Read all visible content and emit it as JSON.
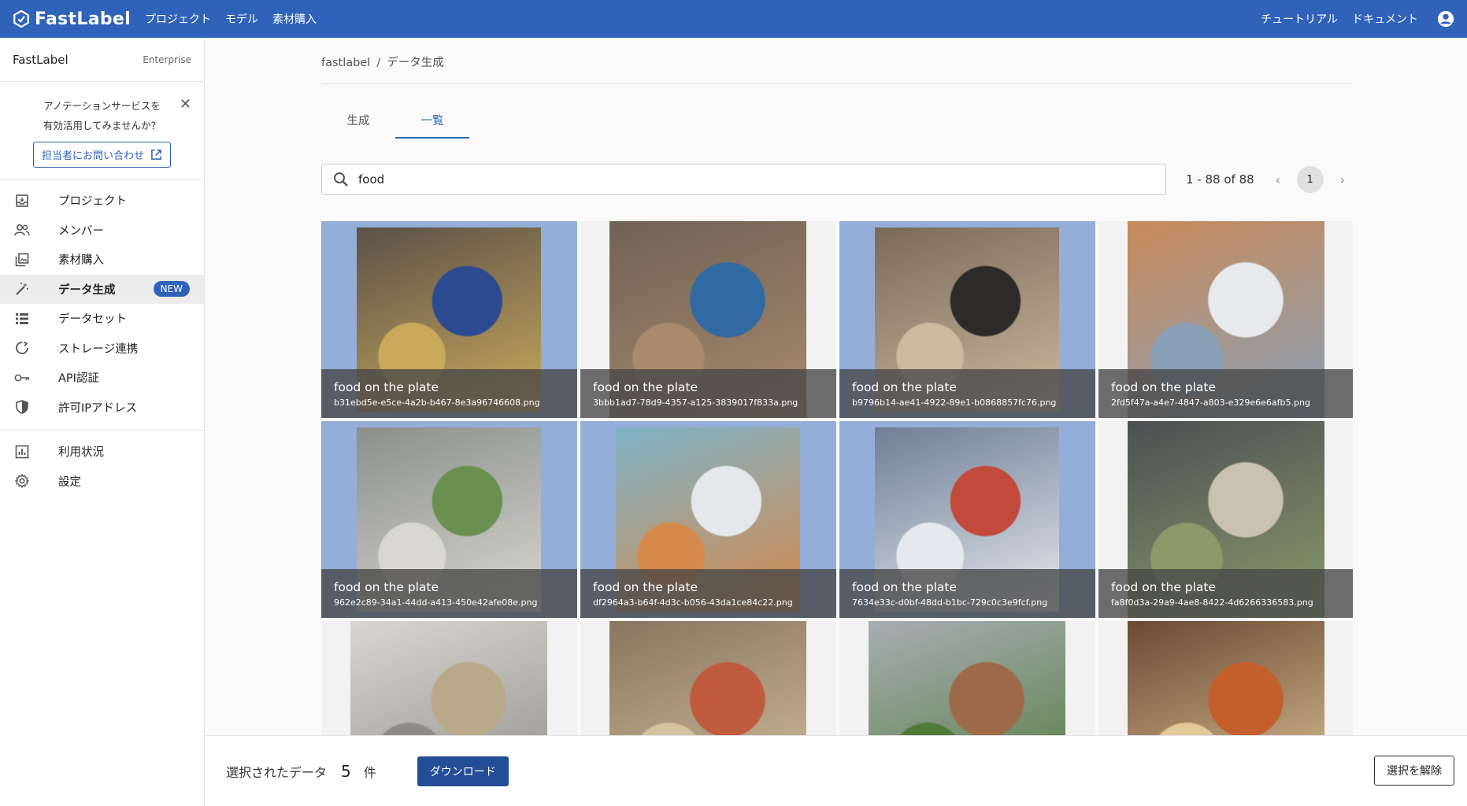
{
  "topbar": {
    "brand": "FastLabel",
    "nav": [
      "プロジェクト",
      "モデル",
      "素材購入"
    ],
    "right_links": [
      "チュートリアル",
      "ドキュメント"
    ]
  },
  "sidebar": {
    "org_name": "FastLabel",
    "plan": "Enterprise",
    "promo": {
      "line1": "アノテーションサービスを",
      "line2": "有効活用してみませんか？",
      "button": "担当者にお問い合わせ"
    },
    "items": [
      {
        "label": "プロジェクト",
        "icon": "inbox-icon"
      },
      {
        "label": "メンバー",
        "icon": "people-icon"
      },
      {
        "label": "素材購入",
        "icon": "gallery-icon"
      },
      {
        "label": "データ生成",
        "icon": "magic-wand-icon",
        "badge": "NEW"
      },
      {
        "label": "データセット",
        "icon": "list-icon"
      },
      {
        "label": "ストレージ連携",
        "icon": "sync-icon"
      },
      {
        "label": "API認証",
        "icon": "key-icon"
      },
      {
        "label": "許可IPアドレス",
        "icon": "shield-icon"
      }
    ],
    "items2": [
      {
        "label": "利用状況",
        "icon": "bar-chart-icon"
      },
      {
        "label": "設定",
        "icon": "gear-icon"
      }
    ]
  },
  "breadcrumb": {
    "root": "fastlabel",
    "sep": "/",
    "current": "データ生成"
  },
  "tabs": [
    "生成",
    "一覧"
  ],
  "search": {
    "value": "food"
  },
  "pagination": {
    "range": "1 - 88 of 88",
    "page": "1"
  },
  "cards": [
    {
      "title": "food on the plate",
      "file": "b31ebd5e-e5ce-4a2b-b467-8e3a96746608.png",
      "selected": true
    },
    {
      "title": "food on the plate",
      "file": "3bbb1ad7-78d9-4357-a125-3839017f833a.png",
      "selected": false
    },
    {
      "title": "food on the plate",
      "file": "b9796b14-ae41-4922-89e1-b0868857fc76.png",
      "selected": true
    },
    {
      "title": "food on the plate",
      "file": "2fd5f47a-a4e7-4847-a803-e329e6e6afb5.png",
      "selected": false
    },
    {
      "title": "food on the plate",
      "file": "962e2c89-34a1-44dd-a413-450e42afe08e.png",
      "selected": true
    },
    {
      "title": "food on the plate",
      "file": "df2964a3-b64f-4d3c-b056-43da1ce84c22.png",
      "selected": true
    },
    {
      "title": "food on the plate",
      "file": "7634e33c-d0bf-48dd-b1bc-729c0c3e9fcf.png",
      "selected": true
    },
    {
      "title": "food on the plate",
      "file": "fa8f0d3a-29a9-4ae8-8422-4d6266336583.png",
      "selected": false
    },
    {
      "title": "",
      "file": "",
      "selected": false
    },
    {
      "title": "",
      "file": "",
      "selected": false
    },
    {
      "title": "",
      "file": "",
      "selected": false
    },
    {
      "title": "",
      "file": "",
      "selected": false
    }
  ],
  "bottombar": {
    "label": "選択されたデータ",
    "count": "5",
    "unit": "件",
    "download": "ダウンロード",
    "clear": "選択を解除"
  },
  "colors": {
    "brand": "#2f63b9",
    "selected": "#94add9",
    "download": "#234d94"
  }
}
